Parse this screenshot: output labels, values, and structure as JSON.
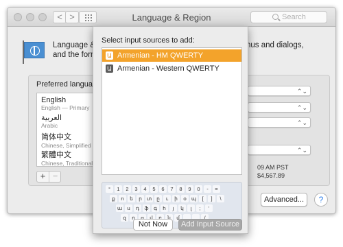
{
  "window": {
    "title": "Language & Region",
    "search_placeholder": "Search",
    "nav_back": "<",
    "nav_forward": ">"
  },
  "description": {
    "line1_left": "Language & R",
    "line2_left": "and the forma",
    "line1_right": "nus and dialogs,"
  },
  "preferred": {
    "label": "Preferred languages:",
    "languages": [
      {
        "name": "English",
        "sub": "English — Primary"
      },
      {
        "name": "العربية",
        "sub": "Arabic"
      },
      {
        "name": "简体中文",
        "sub": "Chinese, Simplified"
      },
      {
        "name": "繁體中文",
        "sub": "Chinese, Traditional"
      }
    ],
    "add": "+",
    "remove": "−"
  },
  "right_panel": {
    "chevron": "⌃⌄",
    "time_info": "09 AM PST",
    "number_info": "$4,567.89",
    "advanced_label": "Advanced...",
    "help_label": "?"
  },
  "sheet": {
    "title": "Select input sources to add:",
    "sources": [
      {
        "icon": "Ա",
        "label": "Armenian - HM QWERTY",
        "selected": true
      },
      {
        "icon": "Ա",
        "label": "Armenian - Western QWERTY",
        "selected": false
      }
    ],
    "keyboard_rows": [
      [
        "°",
        "1",
        "2",
        "3",
        "4",
        "5",
        "6",
        "7",
        "8",
        "9",
        "0",
        "-",
        "="
      ],
      [
        "ք",
        "ո",
        "ե",
        "ր",
        "տ",
        "ը",
        "ւ",
        "ի",
        "օ",
        "պ",
        "[",
        "]",
        "\\"
      ],
      [
        "ա",
        "ս",
        "դ",
        "ֆ",
        "գ",
        "հ",
        "յ",
        "կ",
        "լ",
        ";",
        "'"
      ],
      [
        "զ",
        "ղ",
        "ց",
        "վ",
        "բ",
        "ն",
        "մ",
        ",",
        ".",
        "/"
      ]
    ],
    "not_now_label": "Not Now",
    "add_label": "Add Input Source"
  }
}
